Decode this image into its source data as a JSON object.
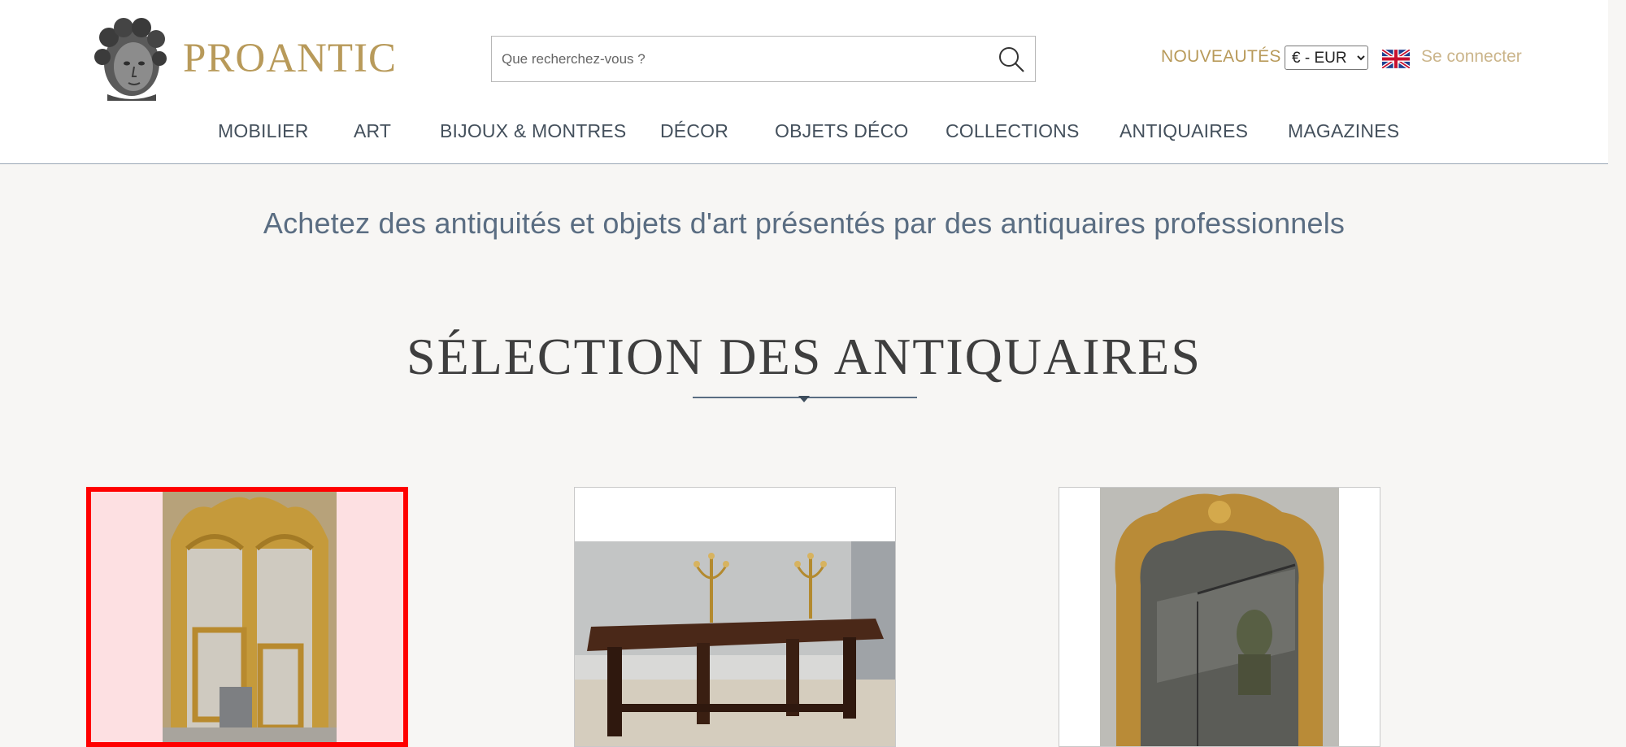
{
  "header": {
    "logo_text": "PROANTIC",
    "search": {
      "placeholder": "Que recherchez-vous ?",
      "value": ""
    },
    "nouveautes_label": "NOUVEAUTÉS",
    "currency": {
      "selected": "€ - EUR"
    },
    "login_label": "Se connecter"
  },
  "nav": {
    "items": [
      {
        "label": "MOBILIER"
      },
      {
        "label": "ART"
      },
      {
        "label": "BIJOUX & MONTRES"
      },
      {
        "label": "DÉCOR"
      },
      {
        "label": "OBJETS DÉCO"
      },
      {
        "label": "COLLECTIONS"
      },
      {
        "label": "ANTIQUAIRES"
      },
      {
        "label": "MAGAZINES"
      }
    ]
  },
  "main": {
    "tagline": "Achetez des antiquités et objets d'art présentés par des antiquaires professionnels",
    "section_title": "SÉLECTION DES ANTIQUAIRES"
  },
  "colors": {
    "accent_gold": "#b89a5a",
    "nav_text": "#44505c",
    "tagline_blue": "#5a6d82",
    "selection_red": "#ff0000"
  },
  "icons": {
    "search": "search-icon",
    "flag": "uk-flag-icon",
    "logo": "bust-logo-icon"
  }
}
